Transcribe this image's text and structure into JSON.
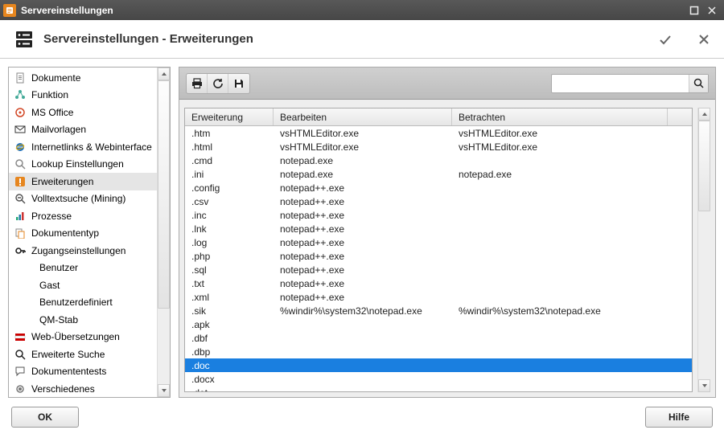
{
  "titlebar": {
    "title": "Servereinstellungen"
  },
  "header": {
    "title": "Servereinstellungen - Erweiterungen"
  },
  "sidebar": {
    "items": [
      {
        "icon": "doc",
        "label": "Dokumente"
      },
      {
        "icon": "func",
        "label": "Funktion"
      },
      {
        "icon": "office",
        "label": "MS Office"
      },
      {
        "icon": "mail",
        "label": "Mailvorlagen"
      },
      {
        "icon": "ie",
        "label": "Internetlinks & Webinterface"
      },
      {
        "icon": "lookup",
        "label": "Lookup Einstellungen"
      },
      {
        "icon": "ext",
        "label": "Erweiterungen",
        "selected": true
      },
      {
        "icon": "mining",
        "label": "Volltextsuche (Mining)"
      },
      {
        "icon": "proc",
        "label": "Prozesse"
      },
      {
        "icon": "doctype",
        "label": "Dokumententyp"
      },
      {
        "icon": "access",
        "label": "Zugangseinstellungen"
      },
      {
        "icon": "",
        "label": "Benutzer",
        "level": 2
      },
      {
        "icon": "",
        "label": "Gast",
        "level": 2
      },
      {
        "icon": "",
        "label": "Benutzerdefiniert",
        "level": 2
      },
      {
        "icon": "",
        "label": "QM-Stab",
        "level": 2
      },
      {
        "icon": "lang",
        "label": "Web-Übersetzungen"
      },
      {
        "icon": "search",
        "label": "Erweiterte Suche"
      },
      {
        "icon": "chat",
        "label": "Dokumententests"
      },
      {
        "icon": "misc",
        "label": "Verschiedenes"
      }
    ]
  },
  "search": {
    "value": "",
    "placeholder": ""
  },
  "table": {
    "columns": [
      "Erweiterung",
      "Bearbeiten",
      "Betrachten"
    ],
    "rows": [
      {
        "ext": ".htm",
        "edit": "vsHTMLEditor.exe",
        "view": "vsHTMLEditor.exe"
      },
      {
        "ext": ".html",
        "edit": "vsHTMLEditor.exe",
        "view": "vsHTMLEditor.exe"
      },
      {
        "ext": ".cmd",
        "edit": "notepad.exe",
        "view": ""
      },
      {
        "ext": ".ini",
        "edit": "notepad.exe",
        "view": "notepad.exe"
      },
      {
        "ext": ".config",
        "edit": "notepad++.exe",
        "view": ""
      },
      {
        "ext": ".csv",
        "edit": "notepad++.exe",
        "view": ""
      },
      {
        "ext": ".inc",
        "edit": "notepad++.exe",
        "view": ""
      },
      {
        "ext": ".lnk",
        "edit": "notepad++.exe",
        "view": ""
      },
      {
        "ext": ".log",
        "edit": "notepad++.exe",
        "view": ""
      },
      {
        "ext": ".php",
        "edit": "notepad++.exe",
        "view": ""
      },
      {
        "ext": ".sql",
        "edit": "notepad++.exe",
        "view": ""
      },
      {
        "ext": ".txt",
        "edit": "notepad++.exe",
        "view": ""
      },
      {
        "ext": ".xml",
        "edit": "notepad++.exe",
        "view": ""
      },
      {
        "ext": ".sik",
        "edit": "%windir%\\system32\\notepad.exe",
        "view": "%windir%\\system32\\notepad.exe"
      },
      {
        "ext": ".apk",
        "edit": "",
        "view": ""
      },
      {
        "ext": ".dbf",
        "edit": "",
        "view": ""
      },
      {
        "ext": ".dbp",
        "edit": "",
        "view": ""
      },
      {
        "ext": ".doc",
        "edit": "",
        "view": "",
        "selected": true
      },
      {
        "ext": ".docx",
        "edit": "",
        "view": ""
      },
      {
        "ext": ".dot",
        "edit": "",
        "view": ""
      }
    ]
  },
  "footer": {
    "ok": "OK",
    "help": "Hilfe"
  },
  "icons": {
    "print": "print-icon",
    "reload": "reload-icon",
    "save": "save-icon",
    "confirm": "check-icon",
    "close": "close-icon",
    "maximize": "maximize-icon",
    "window_close": "close-icon"
  }
}
